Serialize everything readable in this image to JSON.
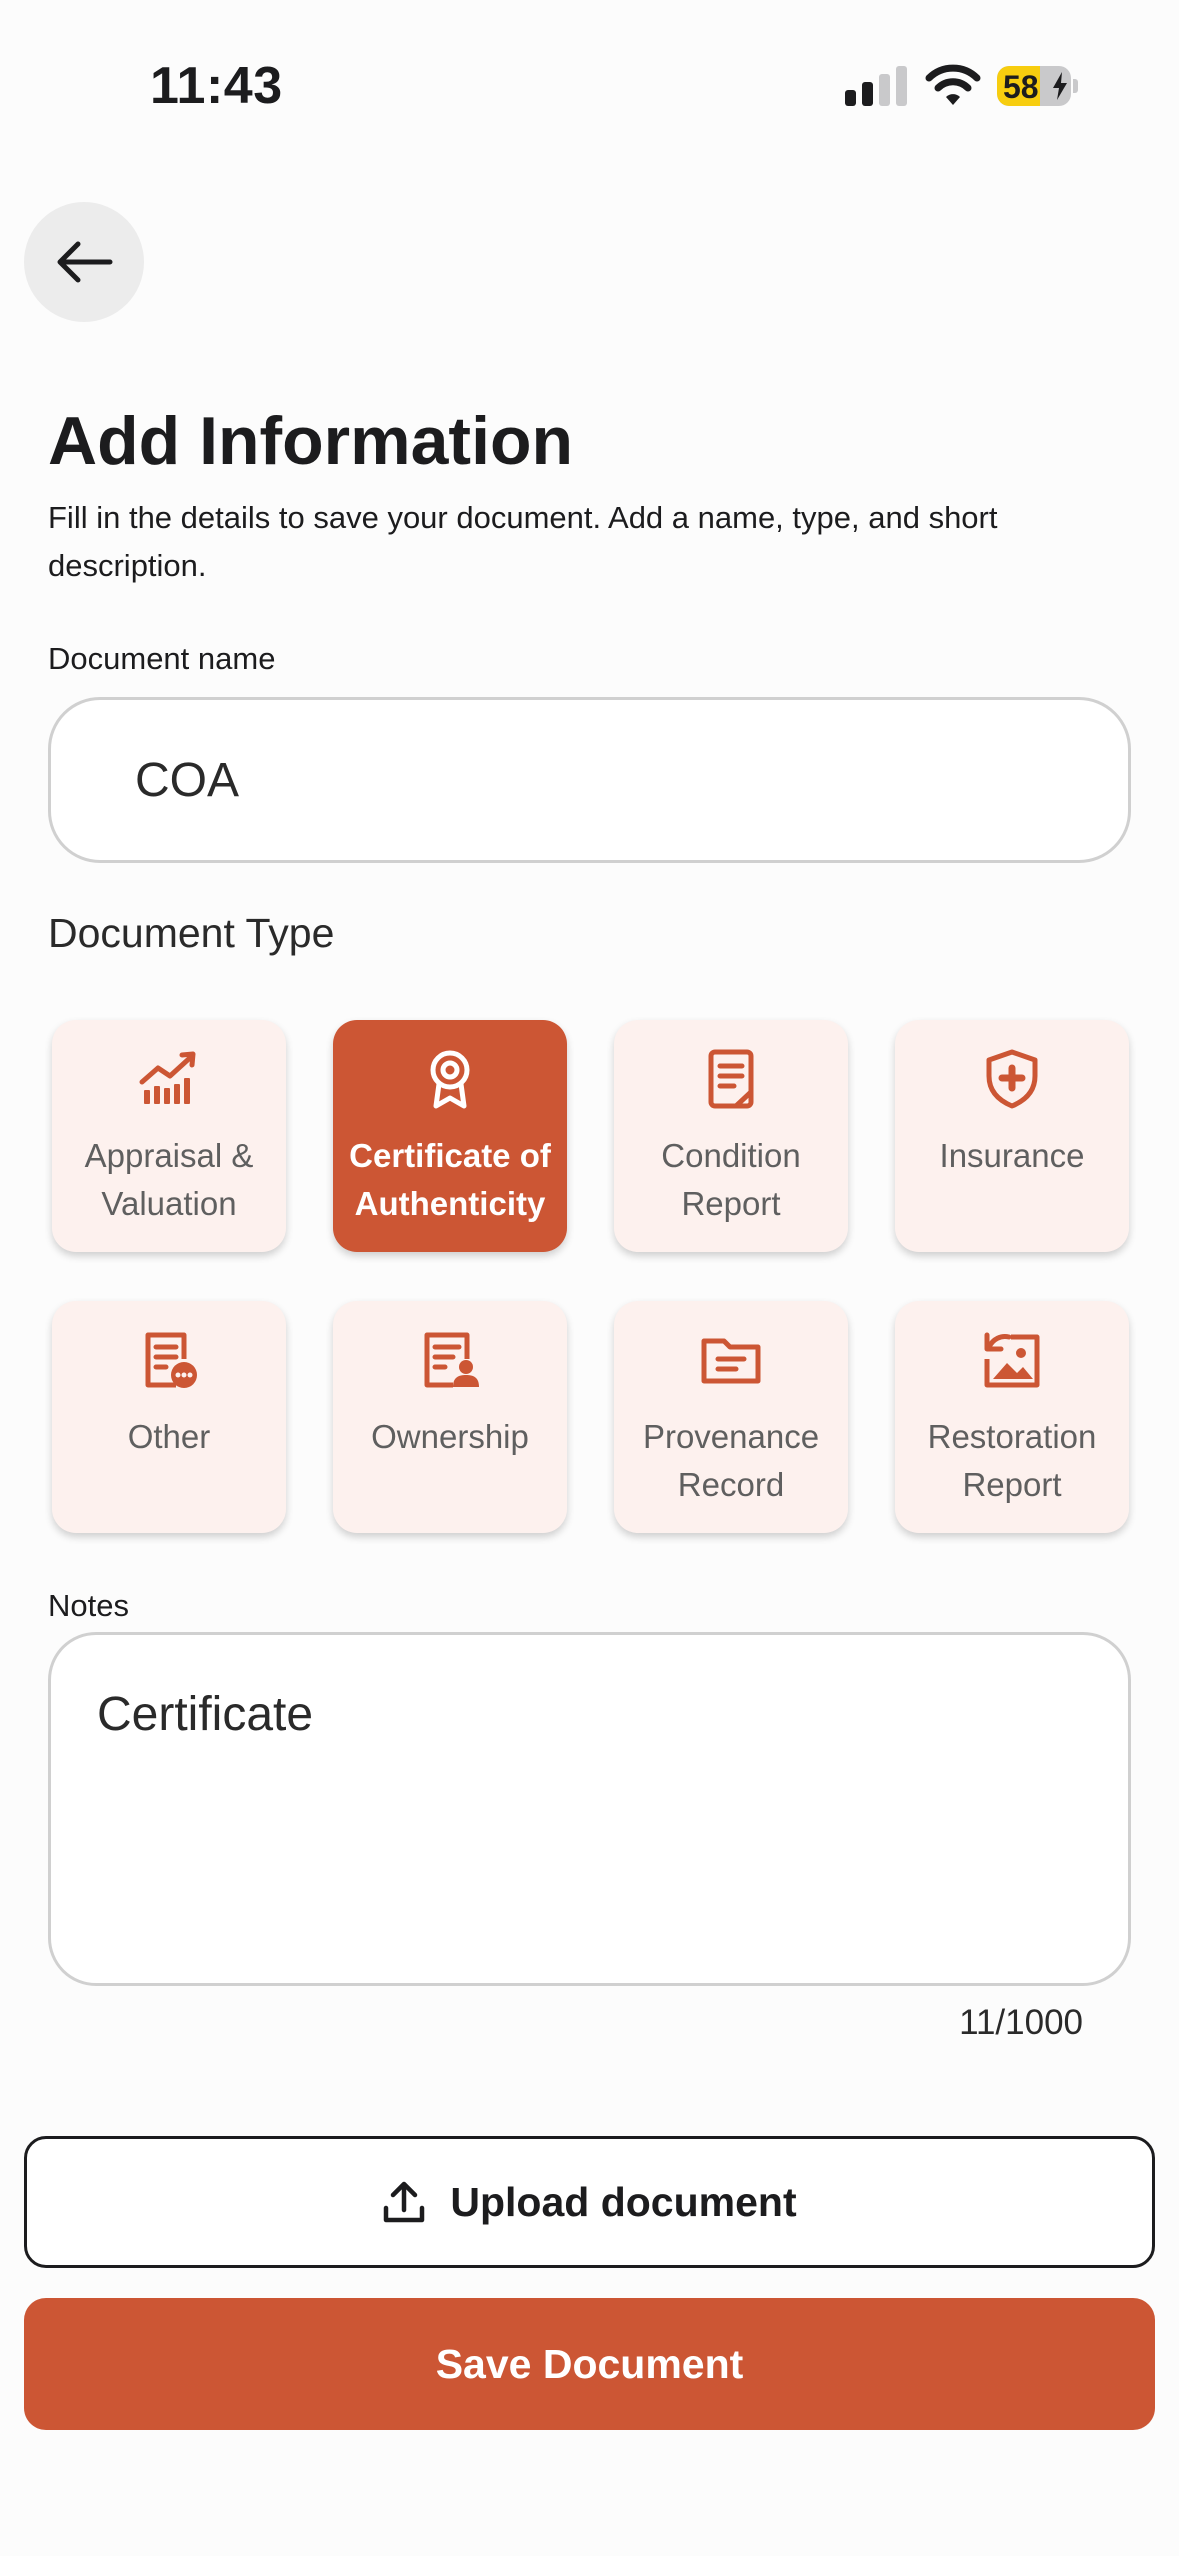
{
  "status_bar": {
    "time": "11:43",
    "battery_level": "58",
    "battery_fraction": 0.58,
    "signal_bars_active": 2,
    "signal_bars_total": 4
  },
  "header": {
    "back_icon": "arrow-left-icon",
    "title": "Add Information",
    "subtitle": "Fill in the details to save your document. Add a name, type, and short description."
  },
  "form": {
    "name_label": "Document name",
    "name_value": "COA",
    "type_label": "Document Type",
    "types": [
      {
        "label": "Appraisal & Valuation",
        "icon": "chart-icon",
        "selected": false
      },
      {
        "label": "Certificate of Authenticity",
        "icon": "award-icon",
        "selected": true
      },
      {
        "label": "Condition Report",
        "icon": "document-icon",
        "selected": false
      },
      {
        "label": "Insurance",
        "icon": "shield-plus-icon",
        "selected": false
      },
      {
        "label": "Other",
        "icon": "document-more-icon",
        "selected": false
      },
      {
        "label": "Ownership",
        "icon": "document-person-icon",
        "selected": false
      },
      {
        "label": "Provenance Record",
        "icon": "folder-icon",
        "selected": false
      },
      {
        "label": "Restoration Report",
        "icon": "image-restore-icon",
        "selected": false
      }
    ],
    "notes_label": "Notes",
    "notes_value": "Certificate",
    "notes_count": "11/1000"
  },
  "actions": {
    "upload_label": "Upload document",
    "upload_icon": "upload-icon",
    "save_label": "Save Document"
  },
  "colors": {
    "accent": "#cc5634",
    "card_bg": "#fdf1ee",
    "battery": "#f7cd0f"
  }
}
